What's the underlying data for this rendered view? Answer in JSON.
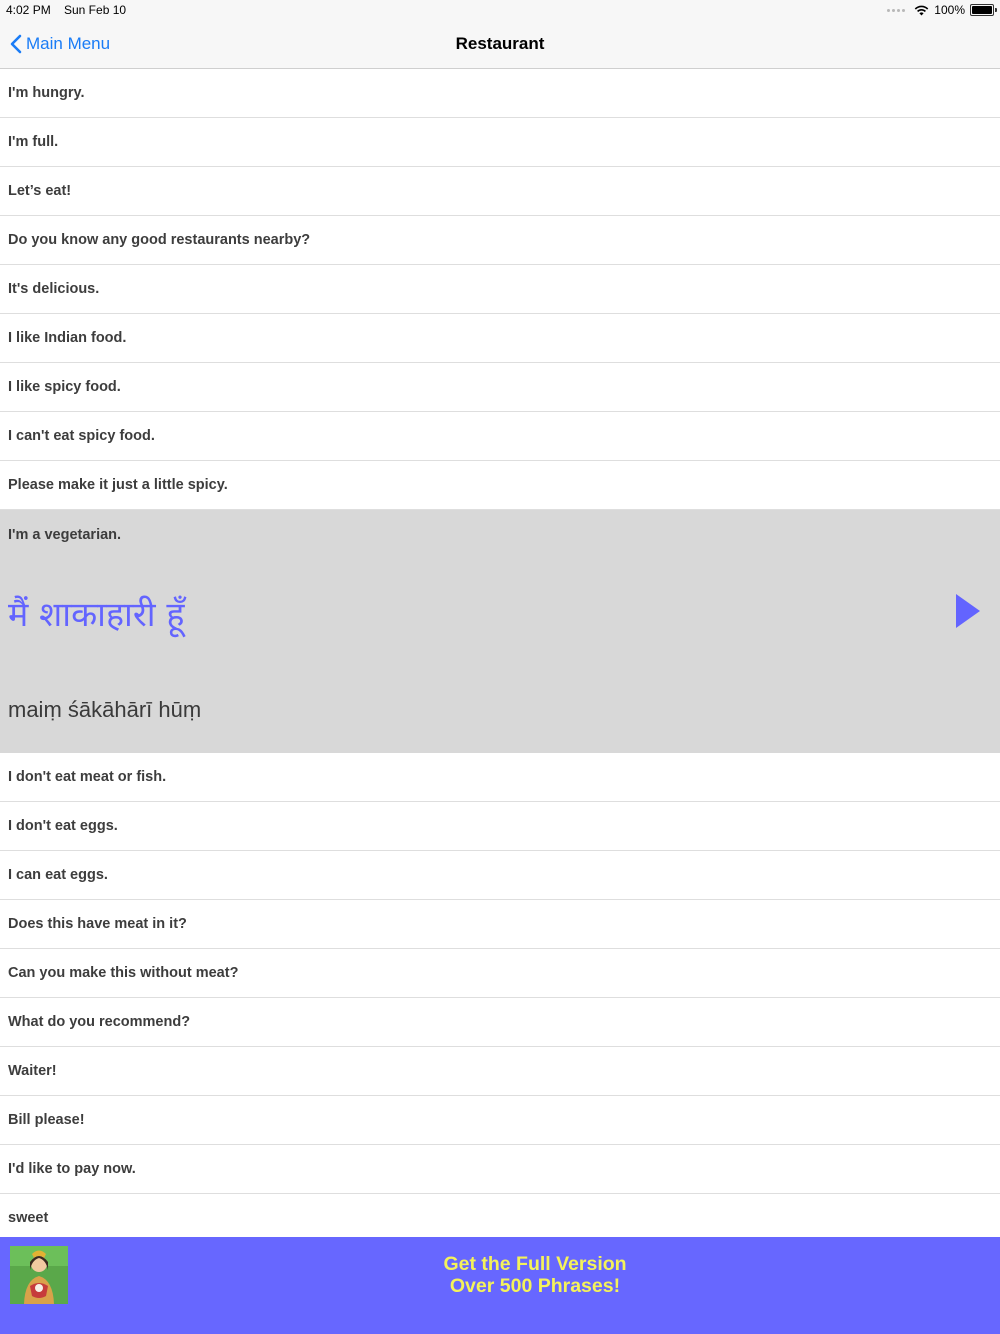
{
  "status_bar": {
    "time": "4:02 PM",
    "date": "Sun Feb 10",
    "battery": "100%"
  },
  "nav": {
    "back_label": "Main Menu",
    "title": "Restaurant"
  },
  "phrases_before": [
    "I'm hungry.",
    "I'm full.",
    "Let’s eat!",
    "Do you know any good restaurants nearby?",
    "It's delicious.",
    "I like Indian food.",
    "I like spicy food.",
    "I can't eat spicy food.",
    "Please make it just a little spicy."
  ],
  "expanded": {
    "english": "I'm a vegetarian.",
    "hindi": "मैं शाकाहारी हूँ",
    "transliteration": "maiṃ śākāhārī hūṃ"
  },
  "phrases_after": [
    "I don't eat meat or fish.",
    "I don't eat eggs.",
    "I can eat eggs.",
    "Does this have meat in it?",
    "Can you make this without meat?",
    "What do you recommend?",
    "Waiter!",
    "Bill please!",
    "I'd like to pay now.",
    "sweet"
  ],
  "banner": {
    "line1": "Get the Full Version",
    "line2": "Over 500 Phrases!"
  },
  "colors": {
    "accent": "#6364ff",
    "banner_bg": "#6767ff",
    "banner_text": "#f4f25a",
    "link": "#1a7cf6"
  }
}
